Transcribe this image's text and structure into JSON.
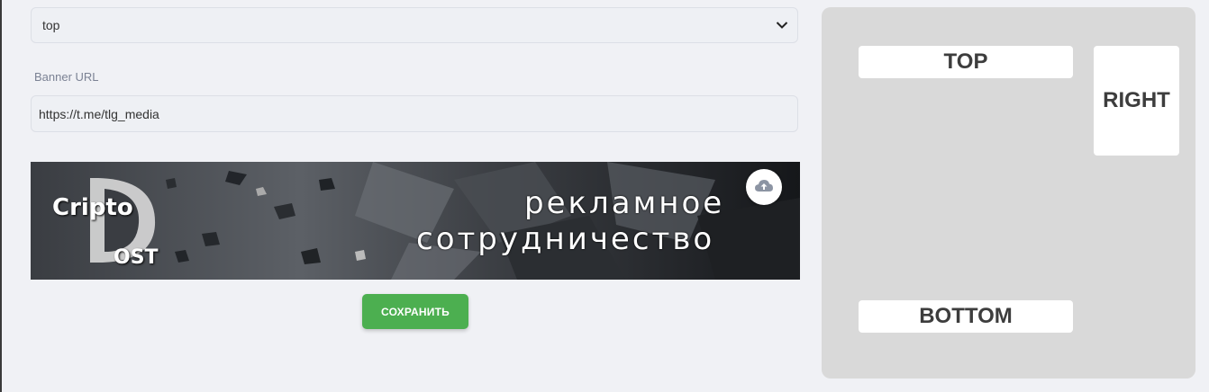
{
  "position_select": {
    "value": "top"
  },
  "banner_url": {
    "label": "Banner URL",
    "value": "https://t.me/tlg_media"
  },
  "banner": {
    "logo_word": "Cripto",
    "logo_ost": "OST",
    "line1": "рекламное",
    "line2": "сотрудничество",
    "upload_icon": "cloud-upload-icon"
  },
  "save_button": {
    "label": "СОХРАНИТЬ"
  },
  "preview": {
    "top": "TOP",
    "right": "RIGHT",
    "bottom": "BOTTOM"
  },
  "colors": {
    "accent": "#4caf50",
    "preview_bg": "#d9d9d9",
    "field_bg": "#eef0f4"
  }
}
